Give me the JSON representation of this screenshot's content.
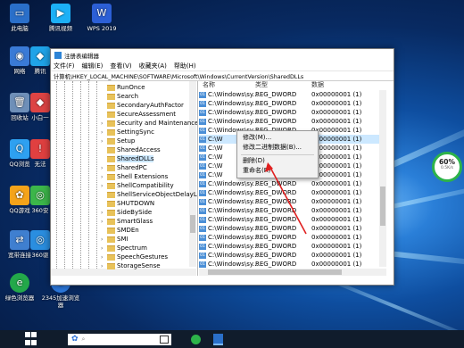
{
  "desktop": {
    "icons": [
      {
        "label": "此电脑",
        "color": "#2a6fc9"
      },
      {
        "label": "腾讯视频",
        "color": "#1cb0f6"
      },
      {
        "label": "WPS 2019",
        "color": "#2c5fd6"
      },
      {
        "label": "网络",
        "color": "#3a7ad6"
      },
      {
        "label": "腾讯",
        "color": "#1fa3e8"
      },
      {
        "label": "回收站",
        "color": "#6e8fb8"
      },
      {
        "label": "小白一",
        "color": "#d44"
      },
      {
        "label": "QQ浏览",
        "color": "#2ea0f0"
      },
      {
        "label": "无法",
        "color": "#e04040"
      },
      {
        "label": "QQ游戏",
        "color": "#f4a31a"
      },
      {
        "label": "360安",
        "color": "#3cb64a"
      },
      {
        "label": "宽带连接",
        "color": "#3f7fd0"
      },
      {
        "label": "360驱",
        "color": "#2a8ee0"
      },
      {
        "label": "绿色浏览器",
        "color": "#23a84a"
      },
      {
        "label": "2345加速浏览器",
        "color": "#2c7ae0"
      }
    ]
  },
  "window": {
    "title": "注册表编辑器",
    "menu": [
      "文件(F)",
      "编辑(E)",
      "查看(V)",
      "收藏夹(A)",
      "帮助(H)"
    ],
    "address": "计算机\\HKEY_LOCAL_MACHINE\\SOFTWARE\\Microsoft\\Windows\\CurrentVersion\\SharedDLLs"
  },
  "tree": {
    "items": [
      {
        "label": "RunOnce",
        "expandable": false
      },
      {
        "label": "Search",
        "expandable": false
      },
      {
        "label": "SecondaryAuthFactor",
        "expandable": false
      },
      {
        "label": "SecureAssessment",
        "expandable": false
      },
      {
        "label": "Security and Maintenance",
        "expandable": true
      },
      {
        "label": "SettingSync",
        "expandable": true
      },
      {
        "label": "Setup",
        "expandable": true
      },
      {
        "label": "SharedAccess",
        "expandable": false
      },
      {
        "label": "SharedDLLs",
        "expandable": false,
        "selected": true
      },
      {
        "label": "SharedPC",
        "expandable": true
      },
      {
        "label": "Shell Extensions",
        "expandable": true
      },
      {
        "label": "ShellCompatibility",
        "expandable": true
      },
      {
        "label": "ShellServiceObjectDelayLoad",
        "expandable": false
      },
      {
        "label": "SHUTDOWN",
        "expandable": false
      },
      {
        "label": "SideBySide",
        "expandable": true
      },
      {
        "label": "SmartGlass",
        "expandable": true
      },
      {
        "label": "SMDEn",
        "expandable": false
      },
      {
        "label": "SMI",
        "expandable": true
      },
      {
        "label": "Spectrum",
        "expandable": true
      },
      {
        "label": "SpeechGestures",
        "expandable": true
      },
      {
        "label": "StorageSense",
        "expandable": true
      }
    ]
  },
  "list": {
    "headers": {
      "name": "名称",
      "type": "类型",
      "data": "数据"
    },
    "rows": [
      {
        "name": "C:\\Windows\\sy...",
        "type": "REG_DWORD",
        "data": "0x00000001 (1)"
      },
      {
        "name": "C:\\Windows\\sy...",
        "type": "REG_DWORD",
        "data": "0x00000001 (1)"
      },
      {
        "name": "C:\\Windows\\sy...",
        "type": "REG_DWORD",
        "data": "0x00000001 (1)"
      },
      {
        "name": "C:\\Windows\\sy...",
        "type": "REG_DWORD",
        "data": "0x00000001 (1)"
      },
      {
        "name": "C:\\Windows\\sy...",
        "type": "REG_DWORD",
        "data": "0x00000001 (1)"
      },
      {
        "name": "C:\\W",
        "type": "",
        "data": "0x00000001 (1)",
        "selected": true
      },
      {
        "name": "C:\\W",
        "type": "",
        "data": "0x00000001 (1)"
      },
      {
        "name": "C:\\W",
        "type": "",
        "data": "0x00000001 (1)"
      },
      {
        "name": "C:\\W",
        "type": "",
        "data": "0x00000001 (1)"
      },
      {
        "name": "C:\\W",
        "type": "",
        "data": "0x00000001 (1)"
      },
      {
        "name": "C:\\Windows\\sy...",
        "type": "REG_DWORD",
        "data": "0x00000001 (1)"
      },
      {
        "name": "C:\\Windows\\sy...",
        "type": "REG_DWORD",
        "data": "0x00000001 (1)"
      },
      {
        "name": "C:\\Windows\\sy...",
        "type": "REG_DWORD",
        "data": "0x00000001 (1)"
      },
      {
        "name": "C:\\Windows\\sy...",
        "type": "REG_DWORD",
        "data": "0x00000001 (1)"
      },
      {
        "name": "C:\\Windows\\sy...",
        "type": "REG_DWORD",
        "data": "0x00000001 (1)"
      },
      {
        "name": "C:\\Windows\\sy...",
        "type": "REG_DWORD",
        "data": "0x00000001 (1)"
      },
      {
        "name": "C:\\Windows\\sy...",
        "type": "REG_DWORD",
        "data": "0x00000001 (1)"
      },
      {
        "name": "C:\\Windows\\sy...",
        "type": "REG_DWORD",
        "data": "0x00000001 (1)"
      },
      {
        "name": "C:\\Windows\\sy...",
        "type": "REG_DWORD",
        "data": "0x00000001 (1)"
      },
      {
        "name": "C:\\Windows\\sy...",
        "type": "REG_DWORD",
        "data": "0x00000001 (1)"
      },
      {
        "name": "C:\\Windows\\sy...",
        "type": "REG_DWORD",
        "data": "0x00000001 (1)"
      }
    ]
  },
  "context_menu": {
    "modify": "修改(M)...",
    "modify_binary": "修改二进制数据(B)...",
    "delete": "删除(D)",
    "rename": "重命名(R)"
  },
  "widget": {
    "percent": "60%",
    "speed": "0.5K/s"
  },
  "colors": {
    "accent_arrow": "#e02020",
    "selection": "#cce8ff",
    "gauge_ring": "#2db34a"
  }
}
